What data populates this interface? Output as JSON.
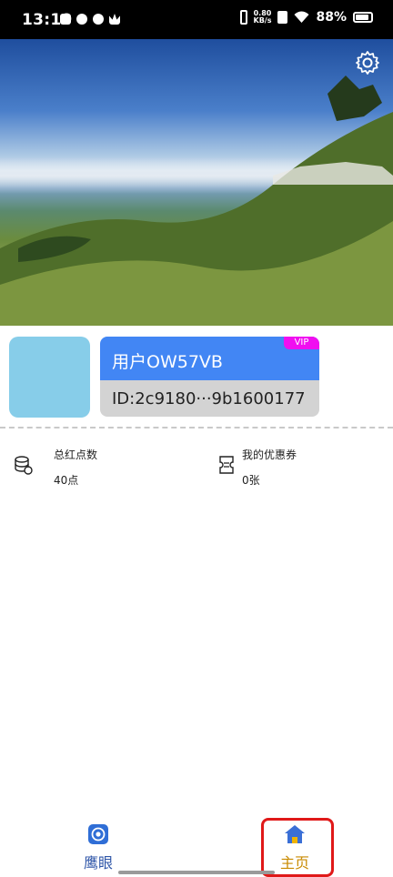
{
  "status_bar": {
    "time": "13:19",
    "net_speed_value": "0.80",
    "net_speed_unit": "KB/s",
    "battery": "88%",
    "battery_level": 0.88
  },
  "header": {
    "settings_icon": "gear-icon"
  },
  "profile": {
    "username": "用户OW57VB",
    "user_id": "ID:2c9180···9b1600177",
    "badge": "VIP",
    "colors": {
      "avatar": "#87cde9",
      "name_band": "#4286f4",
      "id_band": "#d3d3d3",
      "badge": "#f00ff0"
    }
  },
  "stats": {
    "points": {
      "label": "总红点数",
      "value": "40点",
      "icon": "coins-stack-icon"
    },
    "coupons": {
      "label": "我的优惠券",
      "value": "0张",
      "icon": "ticket-icon"
    }
  },
  "nav": {
    "items": [
      {
        "label": "鹰眼",
        "icon": "eye-target-icon",
        "color": "#2f56a8"
      },
      {
        "label": "主页",
        "icon": "home-icon",
        "color": "#c98a00",
        "active": true
      }
    ]
  }
}
